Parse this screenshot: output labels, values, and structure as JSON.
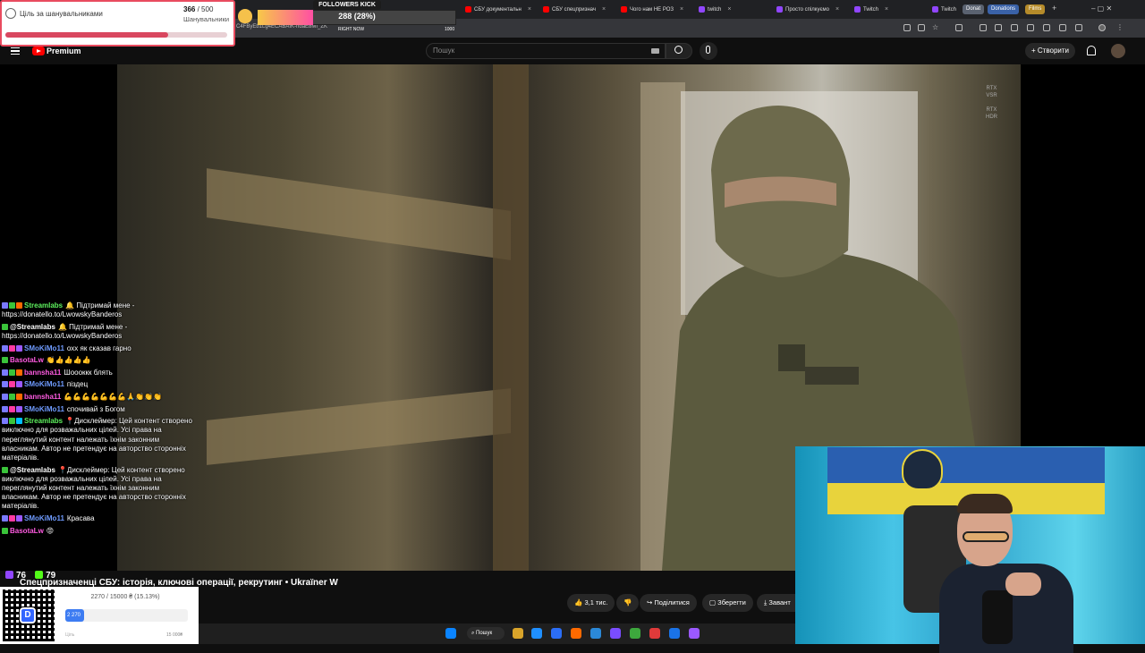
{
  "browser": {
    "tabs": [
      {
        "label": "СБУ документальн",
        "type": "youtube"
      },
      {
        "label": "СБУ спецпризнач",
        "type": "youtube"
      },
      {
        "label": "Чого нам НЕ РОЗ",
        "type": "youtube"
      },
      {
        "label": "twitch",
        "type": "twitch"
      },
      {
        "label": "Просто спілкуємо",
        "type": "twitch"
      },
      {
        "label": "Twitch",
        "type": "twitch"
      },
      {
        "label": "Twitch",
        "type": "twitch"
      }
    ],
    "pinned": [
      {
        "label": "Donat",
        "color": "#5a6270"
      },
      {
        "label": "Donations",
        "color": "#3a62a8"
      },
      {
        "label": "Films",
        "color": "#b58b2a"
      }
    ],
    "new_tab": "+",
    "address": "C4FByEb1Lg4ECABAIK-ndaE8MI_ZK",
    "window_controls": "–  ▢  ✕"
  },
  "youtube": {
    "brand": "Premium",
    "search_placeholder": "Пошук",
    "create_label": "Створити",
    "video_badges": "RTX\nVSR\n\nRTX\nHDR",
    "video_title": "Спецпризначенці СБУ: історія, ключові операції, рекрутинг • Ukraїner W",
    "actions": {
      "likes": "3,1 тис.",
      "share": "Поділитися",
      "save": "Зберегти",
      "download": "Завант"
    }
  },
  "goal": {
    "title": "Ціль за шанувальниками",
    "current": "366",
    "total": "/ 500",
    "subtitle": "Шанувальники",
    "progress": 0.732
  },
  "followers": {
    "title": "FOLLOWERS KICK",
    "value": "288 (28%)",
    "progress": 0.28,
    "now_label": "RIGHT NOW",
    "max_label": "1000"
  },
  "chat": [
    {
      "user": "Streamlabs",
      "color": "#5ef25e",
      "badges": [
        "#7a7aff",
        "#3ac43a",
        "#ff6a00"
      ],
      "text": "🔔 Підтримай мене - https://donatello.to/LwowskyBanderos"
    },
    {
      "user": "@Streamlabs",
      "color": "#ffffff",
      "badges": [
        "#3ac43a"
      ],
      "text": "🔔 Підтримай мене - https://donatello.to/LwowskyBanderos"
    },
    {
      "user": "SMoKiMo11",
      "color": "#6f9bff",
      "badges": [
        "#7a7aff",
        "#ff3aa1",
        "#9b59ff"
      ],
      "text": "охх як сказав гарно"
    },
    {
      "user": "BasotaLw",
      "color": "#ff5be1",
      "badges": [
        "#3ac43a"
      ],
      "text": "👏👍👍👍👍"
    },
    {
      "user": "bannsha11",
      "color": "#ff5be1",
      "badges": [
        "#7a7aff",
        "#3ac43a",
        "#ff6a00"
      ],
      "text": "Шоооккк блять"
    },
    {
      "user": "SMoKiMo11",
      "color": "#6f9bff",
      "badges": [
        "#7a7aff",
        "#ff3aa1",
        "#9b59ff"
      ],
      "text": "піздец"
    },
    {
      "user": "bannsha11",
      "color": "#ff5be1",
      "badges": [
        "#7a7aff",
        "#3ac43a",
        "#ff6a00"
      ],
      "text": "💪💪💪💪💪💪💪🙏👏👏👏"
    },
    {
      "user": "SMoKiMo11",
      "color": "#6f9bff",
      "badges": [
        "#7a7aff",
        "#ff3aa1",
        "#9b59ff"
      ],
      "text": "спочивай з Богом"
    },
    {
      "user": "Streamlabs",
      "color": "#5ef25e",
      "badges": [
        "#7a7aff",
        "#3ac43a",
        "#00bfff"
      ],
      "text": "📍Дисклеймер: Цей контент створено виключно для розважальних цілей. Усі права на переглянутий контент належать їхнім законним власникам. Автор не претендує на авторство сторонніх матеріалів."
    },
    {
      "user": "@Streamlabs",
      "color": "#ffffff",
      "badges": [
        "#3ac43a"
      ],
      "text": "📍Дисклеймер: Цей контент створено виключно для розважальних цілей. Усі права на переглянутий контент належать їхнім законним власникам. Автор не претендує на авторство сторонніх матеріалів."
    },
    {
      "user": "SMoKiMo11",
      "color": "#6f9bff",
      "badges": [
        "#7a7aff",
        "#ff3aa1",
        "#9b59ff"
      ],
      "text": "Красава"
    },
    {
      "user": "BasotaLw",
      "color": "#ff5be1",
      "badges": [
        "#3ac43a"
      ],
      "text": "😡"
    }
  ],
  "stats": {
    "viewers": "76",
    "kick": "79"
  },
  "donation": {
    "progress_text": "2270 / 15000 ₴ (15.13%)",
    "fill_label": "2 270",
    "progress": 0.1513,
    "goal_label": "Ціль",
    "max_label": "15 000₴",
    "qr_logo": "D"
  },
  "taskbar": {
    "search_label": "Пошук",
    "apps": [
      "#0a84ff",
      "#555",
      "#d9a42a",
      "#1f8fff",
      "#2b6ef6",
      "#ff6a00",
      "#2b88d8",
      "#7a4dff",
      "#3da83d",
      "#e03a3a",
      "#1a73e8",
      "#9b59ff"
    ]
  }
}
